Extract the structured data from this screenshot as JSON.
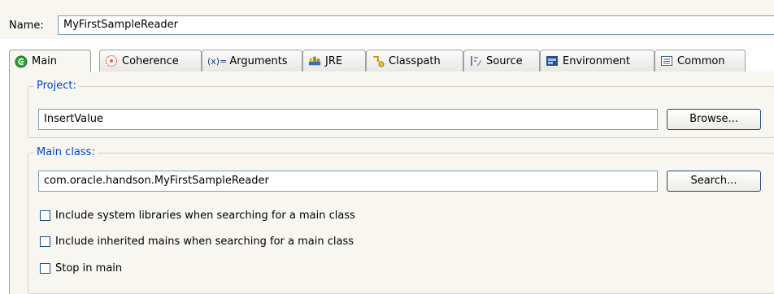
{
  "name": {
    "label": "Name:",
    "value": "MyFirstSampleReader"
  },
  "tabs": [
    {
      "label": "Main",
      "icon": "main-icon"
    },
    {
      "label": "Coherence",
      "icon": "coherence-icon"
    },
    {
      "label": "Arguments",
      "icon": "arguments-icon",
      "icon_text": "(x)="
    },
    {
      "label": "JRE",
      "icon": "jre-icon"
    },
    {
      "label": "Classpath",
      "icon": "classpath-icon"
    },
    {
      "label": "Source",
      "icon": "source-icon"
    },
    {
      "label": "Environment",
      "icon": "environment-icon"
    },
    {
      "label": "Common",
      "icon": "common-icon"
    }
  ],
  "project": {
    "title": "Project:",
    "value": "InsertValue",
    "browse_label": "Browse..."
  },
  "main_class": {
    "title": "Main class:",
    "value": "com.oracle.handson.MyFirstSampleReader",
    "search_label": "Search..."
  },
  "options": [
    {
      "label": "Include system libraries when searching for a main class",
      "checked": false
    },
    {
      "label": "Include inherited mains when searching for a main class",
      "checked": false
    },
    {
      "label": "Stop in main",
      "checked": false
    }
  ],
  "colors": {
    "group_title": "#0046d5",
    "panel_bg": "#f7f6f1",
    "field_border": "#7f9db9"
  }
}
